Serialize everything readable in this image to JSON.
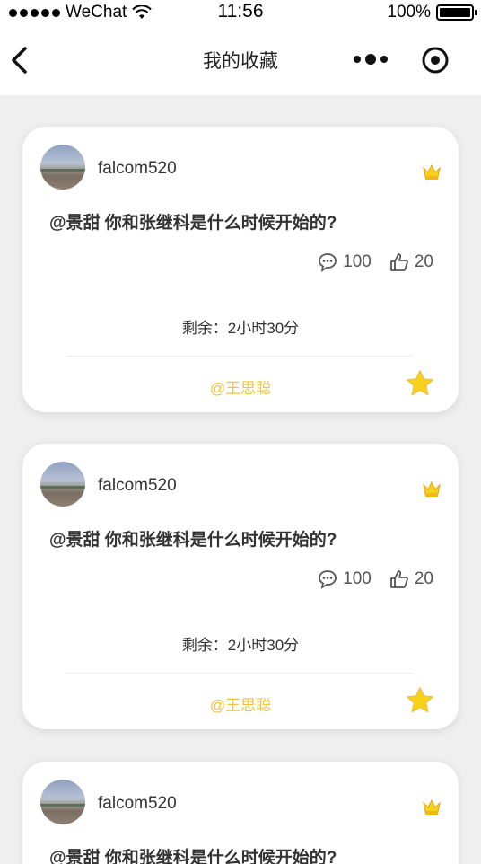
{
  "status_bar": {
    "carrier": "WeChat",
    "time": "11:56",
    "battery": "100%"
  },
  "nav": {
    "title": "我的收藏"
  },
  "cards": [
    {
      "username": "falcom520",
      "question": "@景甜 你和张继科是什么时候开始的?",
      "comments": "100",
      "likes": "20",
      "remaining": "剩余：2小时30分",
      "mention": "@王思聪"
    },
    {
      "username": "falcom520",
      "question": "@景甜 你和张继科是什么时候开始的?",
      "comments": "100",
      "likes": "20",
      "remaining": "剩余：2小时30分",
      "mention": "@王思聪"
    },
    {
      "username": "falcom520",
      "question": "@景甜 你和张继科是什么时候开始的?"
    }
  ],
  "colors": {
    "accent_yellow": "#f2c23a",
    "star_yellow": "#f7d21c",
    "background": "#efefef"
  },
  "icons": [
    "back-icon",
    "more-icon",
    "target-icon",
    "crown-icon",
    "comment-icon",
    "thumbs-up-icon",
    "star-icon"
  ]
}
